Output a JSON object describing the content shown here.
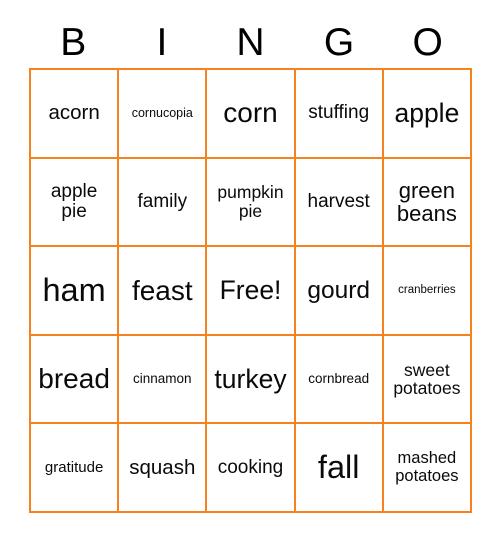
{
  "card": {
    "title": "BINGO",
    "accent_color": "#F5821F",
    "text_color": "#0a0a0a",
    "background_color": "#ffffff",
    "columns": 5,
    "rows": 5,
    "free_space_label": "Free!",
    "free_space_position": "center"
  },
  "header": {
    "letters": [
      {
        "label": "B"
      },
      {
        "label": "I"
      },
      {
        "label": "N"
      },
      {
        "label": "G"
      },
      {
        "label": "O"
      }
    ]
  },
  "grid": {
    "cells": [
      {
        "label": "acorn",
        "size": "fs-20",
        "lines": 1,
        "free": false
      },
      {
        "label": "cornucopia",
        "size": "fs-12",
        "lines": 1,
        "free": false
      },
      {
        "label": "corn",
        "size": "fs-28",
        "lines": 1,
        "free": false
      },
      {
        "label": "stuffing",
        "size": "fs-19",
        "lines": 1,
        "free": false
      },
      {
        "label": "apple",
        "size": "fs-26",
        "lines": 1,
        "free": false
      },
      {
        "label": "apple\npie",
        "size": "fs-19",
        "lines": 2,
        "free": false
      },
      {
        "label": "family",
        "size": "fs-19",
        "lines": 1,
        "free": false
      },
      {
        "label": "pumpkin\npie",
        "size": "fs-17",
        "lines": 2,
        "free": false
      },
      {
        "label": "harvest",
        "size": "fs-19",
        "lines": 1,
        "free": false
      },
      {
        "label": "green\nbeans",
        "size": "fs-22",
        "lines": 2,
        "free": false
      },
      {
        "label": "ham",
        "size": "fs-32",
        "lines": 1,
        "free": false
      },
      {
        "label": "feast",
        "size": "fs-28",
        "lines": 1,
        "free": false
      },
      {
        "label": "Free!",
        "size": "fs-26",
        "lines": 1,
        "free": true
      },
      {
        "label": "gourd",
        "size": "fs-24",
        "lines": 1,
        "free": false
      },
      {
        "label": "cranberries",
        "size": "fs-11",
        "lines": 1,
        "free": false
      },
      {
        "label": "bread",
        "size": "fs-28",
        "lines": 1,
        "free": false
      },
      {
        "label": "cinnamon",
        "size": "fs-13",
        "lines": 1,
        "free": false
      },
      {
        "label": "turkey",
        "size": "fs-26",
        "lines": 1,
        "free": false
      },
      {
        "label": "cornbread",
        "size": "fs-13",
        "lines": 1,
        "free": false
      },
      {
        "label": "sweet\npotatoes",
        "size": "fs-17",
        "lines": 2,
        "free": false
      },
      {
        "label": "gratitude",
        "size": "fs-15",
        "lines": 1,
        "free": false
      },
      {
        "label": "squash",
        "size": "fs-20",
        "lines": 1,
        "free": false
      },
      {
        "label": "cooking",
        "size": "fs-19",
        "lines": 1,
        "free": false
      },
      {
        "label": "fall",
        "size": "fs-32",
        "lines": 1,
        "free": false
      },
      {
        "label": "mashed\npotatoes",
        "size": "fs-16",
        "lines": 2,
        "free": false
      }
    ]
  }
}
